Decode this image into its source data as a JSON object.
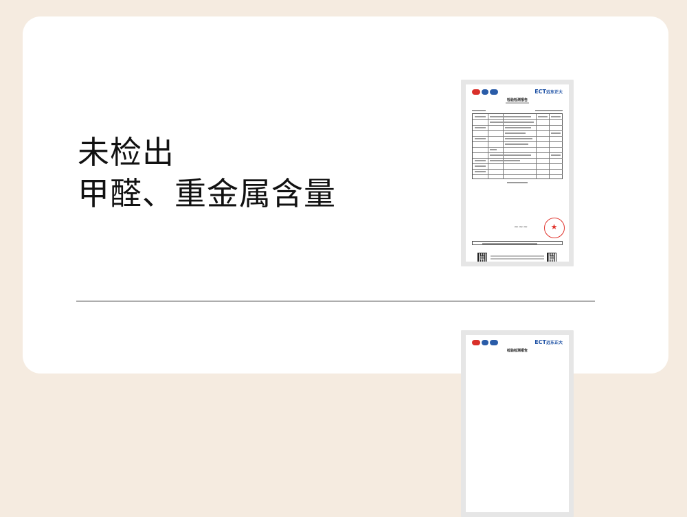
{
  "headline": {
    "line1": "未检出",
    "line2": "甲醛、重金属含量"
  },
  "report_top": {
    "brand": "ECT",
    "brand_cn": "远东正大",
    "title": "检验检测报告"
  },
  "report_bottom": {
    "brand": "ECT",
    "brand_cn": "远东正大",
    "title": "检验检测报告"
  },
  "colors": {
    "page_bg": "#f5ebe0",
    "card_bg": "#ffffff",
    "text": "#111111",
    "brand_blue": "#1b4fa3",
    "seal_red": "#e0332c"
  }
}
